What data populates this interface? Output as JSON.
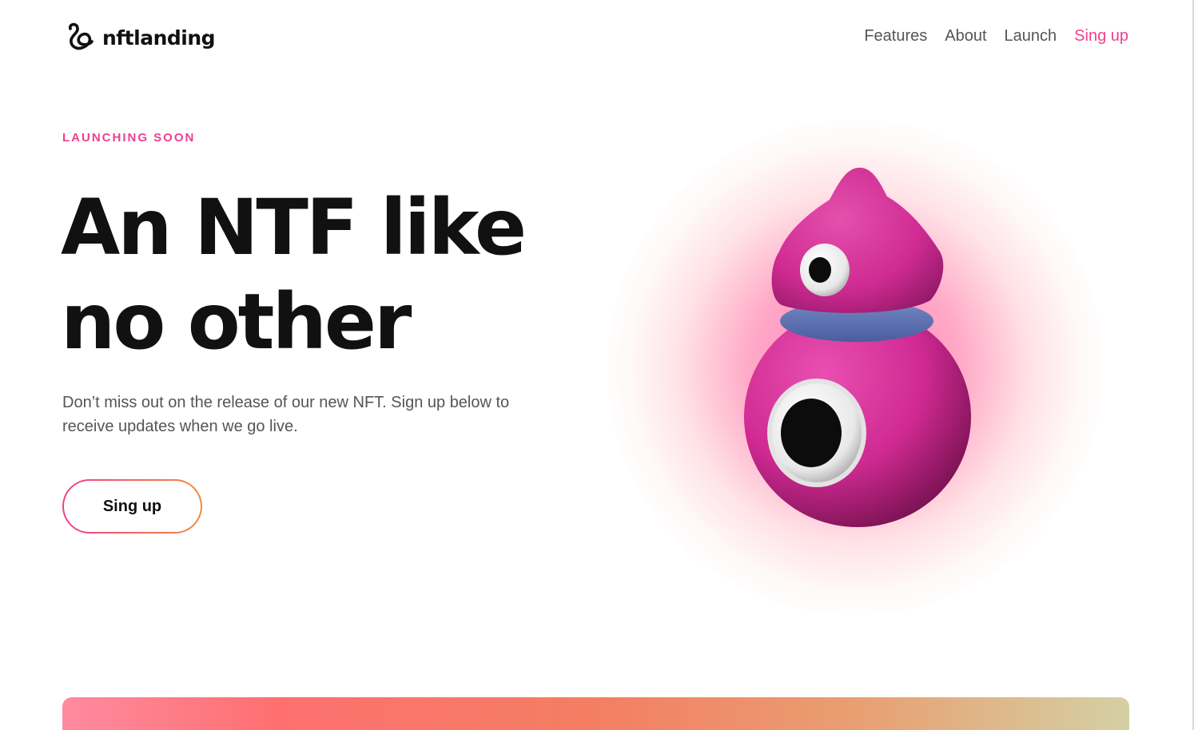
{
  "brand": {
    "name": "nftlanding",
    "logo_icon": "swirl-logo-icon"
  },
  "nav": {
    "items": [
      {
        "label": "Features"
      },
      {
        "label": "About"
      },
      {
        "label": "Launch"
      },
      {
        "label": "Sing up"
      }
    ]
  },
  "hero": {
    "eyebrow": "LAUNCHING SOON",
    "headline_line1": "An NTF like",
    "headline_line2": "no other",
    "subtext": "Don’t miss out on the release of our new NFT. Sign up below to receive updates when we go live.",
    "cta_label": "Sing up"
  },
  "colors": {
    "accent": "#ef3f8f",
    "cta_gradient_start": "#ef3f8f",
    "cta_gradient_end": "#f28a3c",
    "heading": "#111111",
    "body_text": "#555555",
    "creature": "#d92c94",
    "collar": "#5a72b5"
  }
}
